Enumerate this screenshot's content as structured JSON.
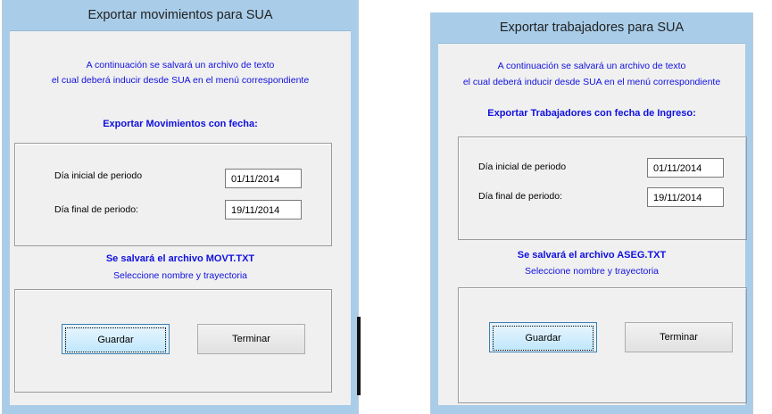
{
  "dialog_movements": {
    "title": "Exportar movimientos para SUA",
    "intro_line1": "A continuación se salvará un archivo de texto",
    "intro_line2": "el cual deberá inducir desde SUA en el menú correspondiente",
    "heading": "Exportar Movimientos con fecha:",
    "start_label": "Día inicial de periodo",
    "start_value": "01/11/2014",
    "end_label": "Día final de periodo:",
    "end_value": "19/11/2014",
    "file_note": "Se salvará el archivo MOVT.TXT",
    "select_note": "Seleccione nombre y trayectoria",
    "save_label": "Guardar",
    "finish_label": "Terminar"
  },
  "dialog_workers": {
    "title": "Exportar trabajadores para SUA",
    "intro_line1": "A continuación se salvará un archivo de texto",
    "intro_line2": "el cual deberá inducir desde SUA en el menú correspondiente",
    "heading": "Exportar Trabajadores con fecha de Ingreso:",
    "start_label": "Día inicial de periodo",
    "start_value": "01/11/2014",
    "end_label": "Día final de periodo:",
    "end_value": "19/11/2014",
    "file_note": "Se salvará el archivo ASEG.TXT",
    "select_note": "Seleccione nombre y trayectoria",
    "save_label": "Guardar",
    "finish_label": "Terminar"
  },
  "colors": {
    "frame": "#a9cde9",
    "body": "#f0f0f0",
    "info_text": "#1010e0"
  }
}
